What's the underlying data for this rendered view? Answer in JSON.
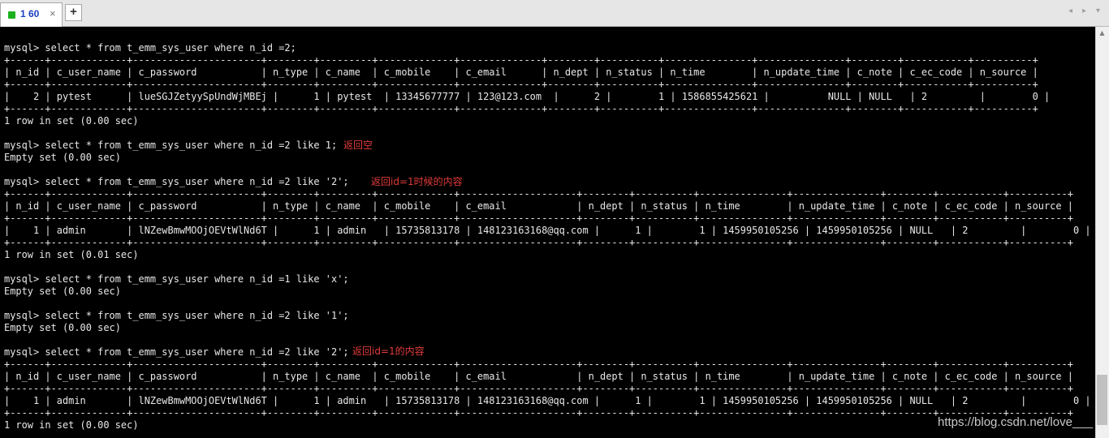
{
  "tabbar": {
    "tab_label": "1 60",
    "close_glyph": "×",
    "add_glyph": "+",
    "nav_left_glyph": "◂",
    "nav_right_glyph": "▸",
    "nav_menu_glyph": "▾"
  },
  "terminal": {
    "lines": [
      "",
      "mysql> select * from t_emm_sys_user where n_id =2;",
      "+------+-------------+----------------------+--------+---------+-------------+--------------+--------+----------+---------------+---------------+--------+-----------+----------+",
      "| n_id | c_user_name | c_password           | n_type | c_name  | c_mobile    | c_email      | n_dept | n_status | n_time        | n_update_time | c_note | c_ec_code | n_source |",
      "+------+-------------+----------------------+--------+---------+-------------+--------------+--------+----------+---------------+---------------+--------+-----------+----------+",
      "|    2 | pytest      | lueSGJZetyySpUndWjMBEj |      1 | pytest  | 13345677777 | 123@123.com  |      2 |        1 | 1586855425621 |          NULL | NULL   | 2         |        0 |",
      "+------+-------------+----------------------+--------+---------+-------------+--------------+--------+----------+---------------+---------------+--------+-----------+----------+",
      "1 row in set (0.00 sec)",
      "",
      "mysql> select * from t_emm_sys_user where n_id =2 like 1;",
      "Empty set (0.00 sec)",
      "",
      "mysql> select * from t_emm_sys_user where n_id =2 like '2';",
      "+------+-------------+----------------------+--------+---------+-------------+--------------------+--------+----------+---------------+---------------+--------+-----------+----------+",
      "| n_id | c_user_name | c_password           | n_type | c_name  | c_mobile    | c_email            | n_dept | n_status | n_time        | n_update_time | c_note | c_ec_code | n_source |",
      "+------+-------------+----------------------+--------+---------+-------------+--------------------+--------+----------+---------------+---------------+--------+-----------+----------+",
      "|    1 | admin       | lNZewBmwMOOjOEVtWlNd6T |      1 | admin   | 15735813178 | 148123163168@qq.com |      1 |        1 | 1459950105256 | 1459950105256 | NULL   | 2         |        0 |",
      "+------+-------------+----------------------+--------+---------+-------------+--------------------+--------+----------+---------------+---------------+--------+-----------+----------+",
      "1 row in set (0.01 sec)",
      "",
      "mysql> select * from t_emm_sys_user where n_id =1 like 'x';",
      "Empty set (0.00 sec)",
      "",
      "mysql> select * from t_emm_sys_user where n_id =2 like '1';",
      "Empty set (0.00 sec)",
      "",
      "mysql> select * from t_emm_sys_user where n_id =2 like '2';",
      "+------+-------------+----------------------+--------+---------+-------------+--------------------+--------+----------+---------------+---------------+--------+-----------+----------+",
      "| n_id | c_user_name | c_password           | n_type | c_name  | c_mobile    | c_email            | n_dept | n_status | n_time        | n_update_time | c_note | c_ec_code | n_source |",
      "+------+-------------+----------------------+--------+---------+-------------+--------------------+--------+----------+---------------+---------------+--------+-----------+----------+",
      "|    1 | admin       | lNZewBmwMOOjOEVtWlNd6T |      1 | admin   | 15735813178 | 148123163168@qq.com |      1 |        1 | 1459950105256 | 1459950105256 | NULL   | 2         |        0 |",
      "+------+-------------+----------------------+--------+---------+-------------+--------------------+--------+----------+---------------+---------------+--------+-----------+----------+",
      "1 row in set (0.00 sec)"
    ],
    "text_color": "#e8e8e8",
    "background_color": "#000000"
  },
  "annotations": [
    {
      "text": "返回空",
      "color": "#e33b3b"
    },
    {
      "text": "返回id=1时候的内容",
      "color": "#e33b3b"
    },
    {
      "text": "返回id=1的内容",
      "color": "#e33b3b"
    }
  ],
  "watermark": "https://blog.csdn.net/love___"
}
